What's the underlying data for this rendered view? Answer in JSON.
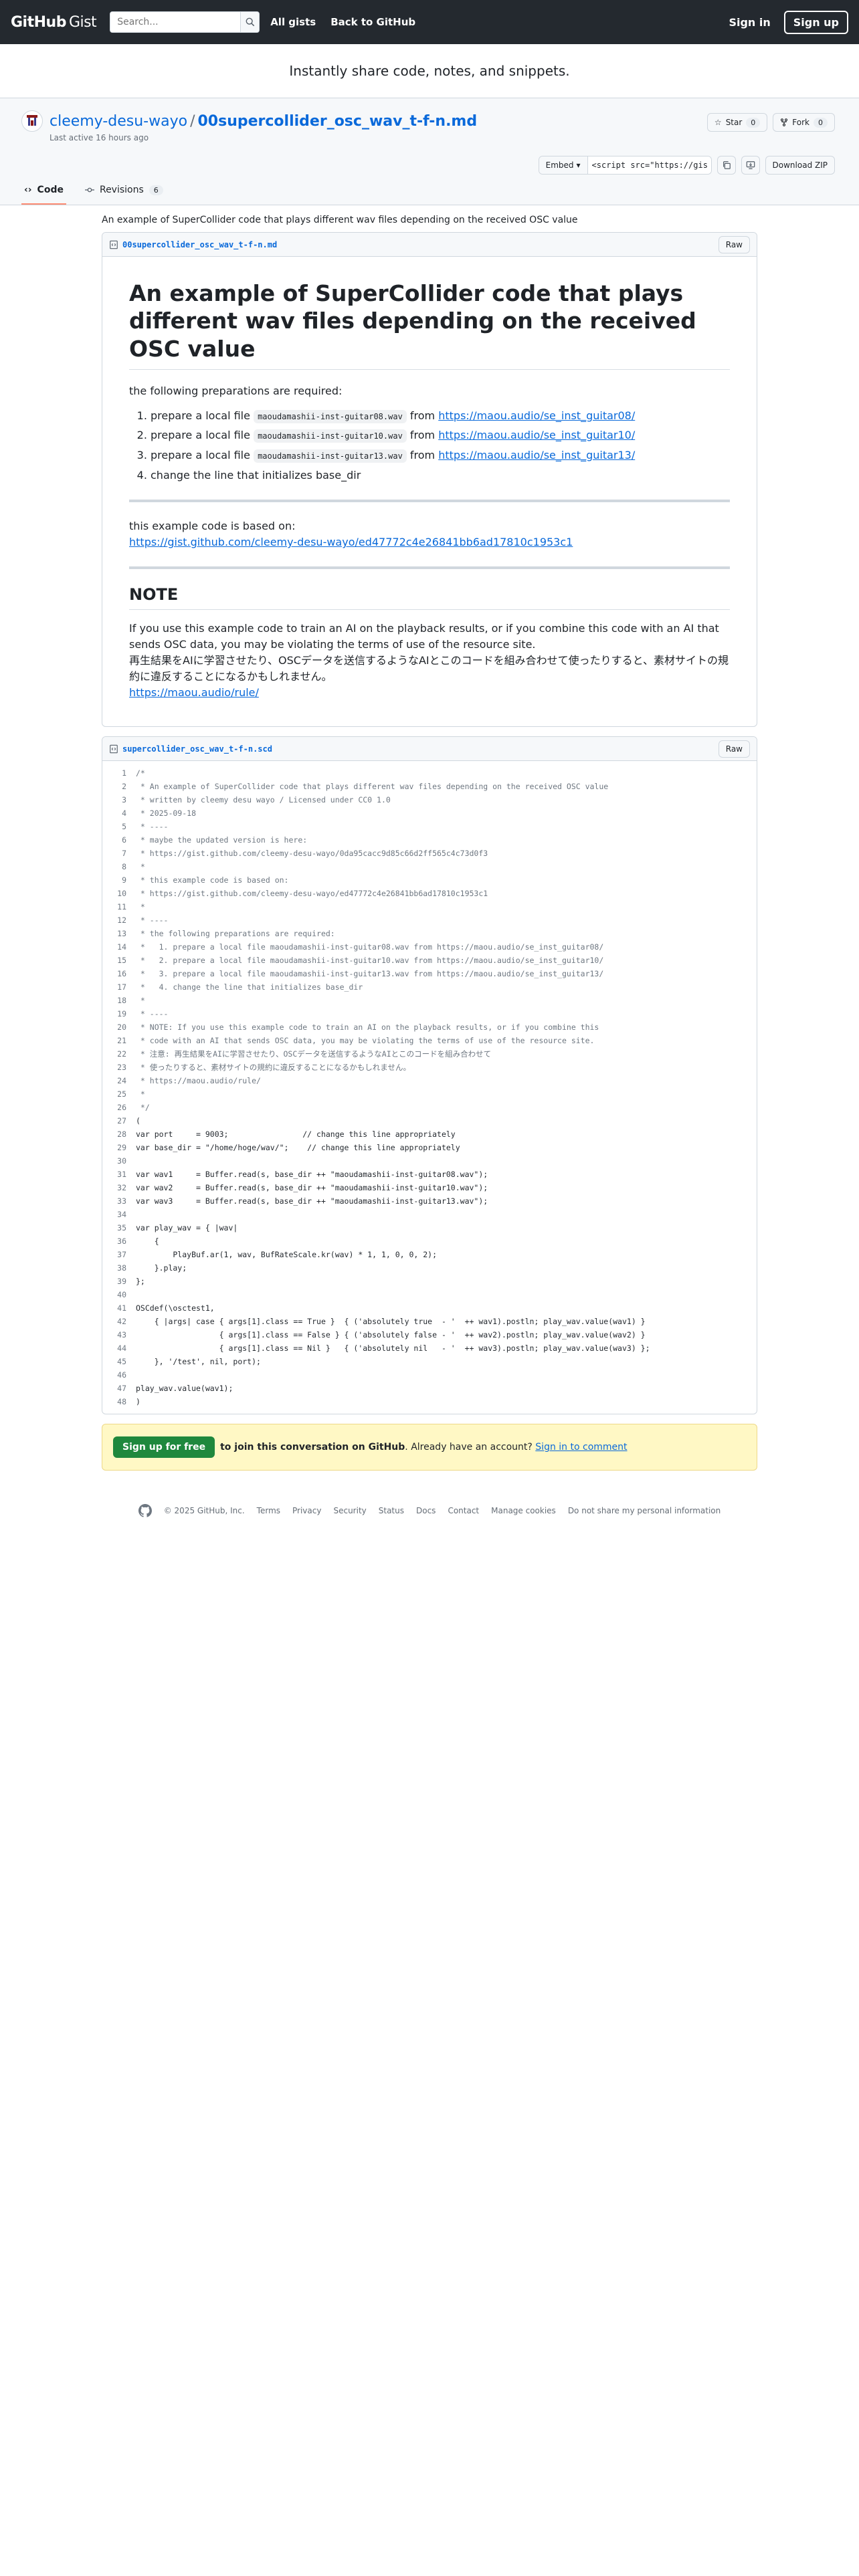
{
  "header": {
    "logo_main": "GitHub",
    "logo_sub": "Gist",
    "search_placeholder": "Search...",
    "nav": [
      "All gists",
      "Back to GitHub"
    ],
    "signin": "Sign in",
    "signup": "Sign up"
  },
  "tagline": "Instantly share code, notes, and snippets.",
  "repo": {
    "owner": "cleemy-desu-wayo",
    "separator": "/",
    "name": "00supercollider_osc_wav_t-f-n.md",
    "last_active": "Last active 16 hours ago",
    "star_label": "Star",
    "star_count": "0",
    "fork_label": "Fork",
    "fork_count": "0",
    "tabs": [
      {
        "label": "Code",
        "active": true
      },
      {
        "label": "Revisions",
        "count": "6"
      }
    ],
    "embed_label": "Embed",
    "embed_value": "<script src=\"https://gist.github.com/cleemy-desu-wayo/",
    "download_zip": "Download ZIP"
  },
  "description": "An example of SuperCollider code that plays different wav files depending on the received OSC value",
  "file1": {
    "name": "00supercollider_osc_wav_t-f-n.md",
    "raw": "Raw",
    "h1": "An example of SuperCollider code that plays different wav files depending on the received OSC value",
    "intro": "the following preparations are required:",
    "items": [
      {
        "pre": "prepare a local file ",
        "code": "maoudamashii-inst-guitar08.wav",
        "mid": " from ",
        "link": "https://maou.audio/se_inst_guitar08/"
      },
      {
        "pre": "prepare a local file ",
        "code": "maoudamashii-inst-guitar10.wav",
        "mid": " from ",
        "link": "https://maou.audio/se_inst_guitar10/"
      },
      {
        "pre": "prepare a local file ",
        "code": "maoudamashii-inst-guitar13.wav",
        "mid": " from ",
        "link": "https://maou.audio/se_inst_guitar13/"
      },
      {
        "pre": "change the line that initializes base_dir",
        "code": "",
        "mid": "",
        "link": ""
      }
    ],
    "based_on": "this example code is based on:",
    "based_link": "https://gist.github.com/cleemy-desu-wayo/ed47772c4e26841bb6ad17810c1953c1",
    "note_title": "NOTE",
    "note_en": "If you use this example code to train an AI on the playback results, or if you combine this code with an AI that sends OSC data, you may be violating the terms of use of the resource site.",
    "note_ja": "再生結果をAIに学習させたり、OSCデータを送信するようなAIとこのコードを組み合わせて使ったりすると、素材サイトの規約に違反することになるかもしれません。",
    "note_link": "https://maou.audio/rule/"
  },
  "file2": {
    "name": "supercollider_osc_wav_t-f-n.scd",
    "raw": "Raw",
    "lines": [
      "/*",
      " * An example of SuperCollider code that plays different wav files depending on the received OSC value",
      " * written by cleemy desu wayo / Licensed under CC0 1.0",
      " * 2025-09-18",
      " * ----",
      " * maybe the updated version is here:",
      " * https://gist.github.com/cleemy-desu-wayo/0da95cacc9d85c66d2ff565c4c73d0f3",
      " *",
      " * this example code is based on:",
      " * https://gist.github.com/cleemy-desu-wayo/ed47772c4e26841bb6ad17810c1953c1",
      " *",
      " * ----",
      " * the following preparations are required:",
      " *   1. prepare a local file maoudamashii-inst-guitar08.wav from https://maou.audio/se_inst_guitar08/",
      " *   2. prepare a local file maoudamashii-inst-guitar10.wav from https://maou.audio/se_inst_guitar10/",
      " *   3. prepare a local file maoudamashii-inst-guitar13.wav from https://maou.audio/se_inst_guitar13/",
      " *   4. change the line that initializes base_dir",
      " *",
      " * ----",
      " * NOTE: If you use this example code to train an AI on the playback results, or if you combine this",
      " * code with an AI that sends OSC data, you may be violating the terms of use of the resource site.",
      " * 注意: 再生結果をAIに学習させたり、OSCデータを送信するようなAIとこのコードを組み合わせて",
      " * 使ったりすると、素材サイトの規約に違反することになるかもしれません。",
      " * https://maou.audio/rule/",
      " *",
      " */",
      "(",
      "var port     = 9003;                // change this line appropriately",
      "var base_dir = \"/home/hoge/wav/\";    // change this line appropriately",
      "",
      "var wav1     = Buffer.read(s, base_dir ++ \"maoudamashii-inst-guitar08.wav\");",
      "var wav2     = Buffer.read(s, base_dir ++ \"maoudamashii-inst-guitar10.wav\");",
      "var wav3     = Buffer.read(s, base_dir ++ \"maoudamashii-inst-guitar13.wav\");",
      "",
      "var play_wav = { |wav|",
      "    {",
      "        PlayBuf.ar(1, wav, BufRateScale.kr(wav) * 1, 1, 0, 0, 2);",
      "    }.play;",
      "};",
      "",
      "OSCdef(\\osctest1,",
      "    { |args| case { args[1].class == True }  { ('absolutely true  - '  ++ wav1).postln; play_wav.value(wav1) }",
      "                  { args[1].class == False } { ('absolutely false - '  ++ wav2).postln; play_wav.value(wav2) }",
      "                  { args[1].class == Nil }   { ('absolutely nil   - '  ++ wav3).postln; play_wav.value(wav3) };",
      "    }, '/test', nil, port);",
      "",
      "play_wav.value(wav1);",
      ")"
    ]
  },
  "cta": {
    "button": "Sign up for free",
    "bold": "to join this conversation on GitHub",
    "text": ". Already have an account? ",
    "link": "Sign in to comment"
  },
  "footer": [
    "© 2025 GitHub, Inc.",
    "Terms",
    "Privacy",
    "Security",
    "Status",
    "Docs",
    "Contact",
    "Manage cookies",
    "Do not share my personal information"
  ]
}
